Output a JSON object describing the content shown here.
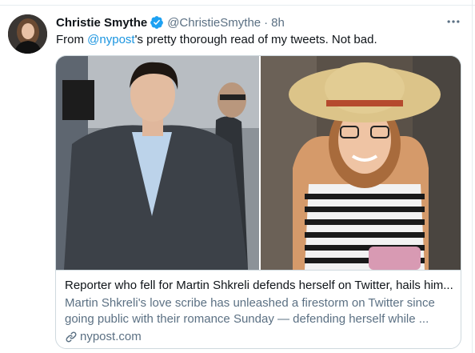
{
  "tweet": {
    "author_name": "Christie Smythe",
    "handle": "@ChristieSmythe",
    "separator": "·",
    "time": "8h",
    "text_before": "From ",
    "mention": "@nypost",
    "text_after": "'s pretty thorough read of my tweets. Not bad."
  },
  "card": {
    "title": "Reporter who fell for Martin Shkreli defends herself on Twitter, hails him...",
    "description_line1": "Martin Shkreli's love scribe has unleashed a firestorm on Twitter since",
    "description_line2": "going public with their romance Sunday — defending herself while ...",
    "domain": "nypost.com"
  },
  "icons": {
    "verified": "verified-badge-icon",
    "more": "more-options-icon",
    "link": "link-icon"
  },
  "colors": {
    "accent": "#1da1f2",
    "mention": "#1b95e0",
    "secondary_text": "#5b7083",
    "border": "#cfd9de"
  }
}
